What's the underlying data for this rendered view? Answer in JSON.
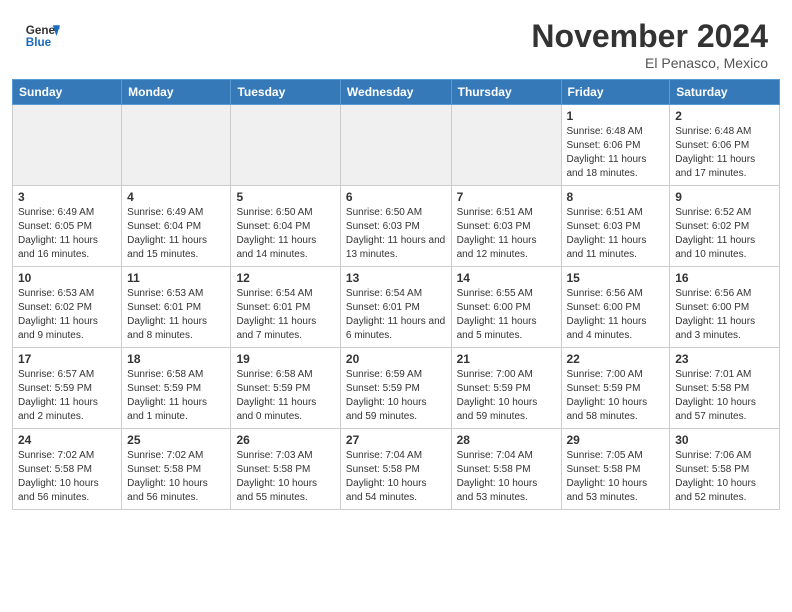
{
  "header": {
    "logo_general": "General",
    "logo_blue": "Blue",
    "month": "November 2024",
    "location": "El Penasco, Mexico"
  },
  "days_of_week": [
    "Sunday",
    "Monday",
    "Tuesday",
    "Wednesday",
    "Thursday",
    "Friday",
    "Saturday"
  ],
  "weeks": [
    [
      {
        "day": "",
        "info": ""
      },
      {
        "day": "",
        "info": ""
      },
      {
        "day": "",
        "info": ""
      },
      {
        "day": "",
        "info": ""
      },
      {
        "day": "",
        "info": ""
      },
      {
        "day": "1",
        "info": "Sunrise: 6:48 AM\nSunset: 6:06 PM\nDaylight: 11 hours and 18 minutes."
      },
      {
        "day": "2",
        "info": "Sunrise: 6:48 AM\nSunset: 6:06 PM\nDaylight: 11 hours and 17 minutes."
      }
    ],
    [
      {
        "day": "3",
        "info": "Sunrise: 6:49 AM\nSunset: 6:05 PM\nDaylight: 11 hours and 16 minutes."
      },
      {
        "day": "4",
        "info": "Sunrise: 6:49 AM\nSunset: 6:04 PM\nDaylight: 11 hours and 15 minutes."
      },
      {
        "day": "5",
        "info": "Sunrise: 6:50 AM\nSunset: 6:04 PM\nDaylight: 11 hours and 14 minutes."
      },
      {
        "day": "6",
        "info": "Sunrise: 6:50 AM\nSunset: 6:03 PM\nDaylight: 11 hours and 13 minutes."
      },
      {
        "day": "7",
        "info": "Sunrise: 6:51 AM\nSunset: 6:03 PM\nDaylight: 11 hours and 12 minutes."
      },
      {
        "day": "8",
        "info": "Sunrise: 6:51 AM\nSunset: 6:03 PM\nDaylight: 11 hours and 11 minutes."
      },
      {
        "day": "9",
        "info": "Sunrise: 6:52 AM\nSunset: 6:02 PM\nDaylight: 11 hours and 10 minutes."
      }
    ],
    [
      {
        "day": "10",
        "info": "Sunrise: 6:53 AM\nSunset: 6:02 PM\nDaylight: 11 hours and 9 minutes."
      },
      {
        "day": "11",
        "info": "Sunrise: 6:53 AM\nSunset: 6:01 PM\nDaylight: 11 hours and 8 minutes."
      },
      {
        "day": "12",
        "info": "Sunrise: 6:54 AM\nSunset: 6:01 PM\nDaylight: 11 hours and 7 minutes."
      },
      {
        "day": "13",
        "info": "Sunrise: 6:54 AM\nSunset: 6:01 PM\nDaylight: 11 hours and 6 minutes."
      },
      {
        "day": "14",
        "info": "Sunrise: 6:55 AM\nSunset: 6:00 PM\nDaylight: 11 hours and 5 minutes."
      },
      {
        "day": "15",
        "info": "Sunrise: 6:56 AM\nSunset: 6:00 PM\nDaylight: 11 hours and 4 minutes."
      },
      {
        "day": "16",
        "info": "Sunrise: 6:56 AM\nSunset: 6:00 PM\nDaylight: 11 hours and 3 minutes."
      }
    ],
    [
      {
        "day": "17",
        "info": "Sunrise: 6:57 AM\nSunset: 5:59 PM\nDaylight: 11 hours and 2 minutes."
      },
      {
        "day": "18",
        "info": "Sunrise: 6:58 AM\nSunset: 5:59 PM\nDaylight: 11 hours and 1 minute."
      },
      {
        "day": "19",
        "info": "Sunrise: 6:58 AM\nSunset: 5:59 PM\nDaylight: 11 hours and 0 minutes."
      },
      {
        "day": "20",
        "info": "Sunrise: 6:59 AM\nSunset: 5:59 PM\nDaylight: 10 hours and 59 minutes."
      },
      {
        "day": "21",
        "info": "Sunrise: 7:00 AM\nSunset: 5:59 PM\nDaylight: 10 hours and 59 minutes."
      },
      {
        "day": "22",
        "info": "Sunrise: 7:00 AM\nSunset: 5:59 PM\nDaylight: 10 hours and 58 minutes."
      },
      {
        "day": "23",
        "info": "Sunrise: 7:01 AM\nSunset: 5:58 PM\nDaylight: 10 hours and 57 minutes."
      }
    ],
    [
      {
        "day": "24",
        "info": "Sunrise: 7:02 AM\nSunset: 5:58 PM\nDaylight: 10 hours and 56 minutes."
      },
      {
        "day": "25",
        "info": "Sunrise: 7:02 AM\nSunset: 5:58 PM\nDaylight: 10 hours and 56 minutes."
      },
      {
        "day": "26",
        "info": "Sunrise: 7:03 AM\nSunset: 5:58 PM\nDaylight: 10 hours and 55 minutes."
      },
      {
        "day": "27",
        "info": "Sunrise: 7:04 AM\nSunset: 5:58 PM\nDaylight: 10 hours and 54 minutes."
      },
      {
        "day": "28",
        "info": "Sunrise: 7:04 AM\nSunset: 5:58 PM\nDaylight: 10 hours and 53 minutes."
      },
      {
        "day": "29",
        "info": "Sunrise: 7:05 AM\nSunset: 5:58 PM\nDaylight: 10 hours and 53 minutes."
      },
      {
        "day": "30",
        "info": "Sunrise: 7:06 AM\nSunset: 5:58 PM\nDaylight: 10 hours and 52 minutes."
      }
    ]
  ]
}
